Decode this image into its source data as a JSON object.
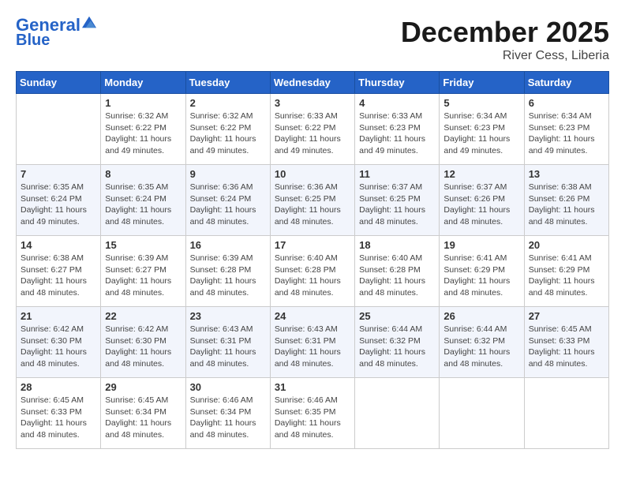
{
  "header": {
    "logo_line1": "General",
    "logo_line2": "Blue",
    "month": "December 2025",
    "location": "River Cess, Liberia"
  },
  "days_of_week": [
    "Sunday",
    "Monday",
    "Tuesday",
    "Wednesday",
    "Thursday",
    "Friday",
    "Saturday"
  ],
  "weeks": [
    [
      {
        "day": "",
        "sunrise": "",
        "sunset": "",
        "daylight": ""
      },
      {
        "day": "1",
        "sunrise": "Sunrise: 6:32 AM",
        "sunset": "Sunset: 6:22 PM",
        "daylight": "Daylight: 11 hours and 49 minutes."
      },
      {
        "day": "2",
        "sunrise": "Sunrise: 6:32 AM",
        "sunset": "Sunset: 6:22 PM",
        "daylight": "Daylight: 11 hours and 49 minutes."
      },
      {
        "day": "3",
        "sunrise": "Sunrise: 6:33 AM",
        "sunset": "Sunset: 6:22 PM",
        "daylight": "Daylight: 11 hours and 49 minutes."
      },
      {
        "day": "4",
        "sunrise": "Sunrise: 6:33 AM",
        "sunset": "Sunset: 6:23 PM",
        "daylight": "Daylight: 11 hours and 49 minutes."
      },
      {
        "day": "5",
        "sunrise": "Sunrise: 6:34 AM",
        "sunset": "Sunset: 6:23 PM",
        "daylight": "Daylight: 11 hours and 49 minutes."
      },
      {
        "day": "6",
        "sunrise": "Sunrise: 6:34 AM",
        "sunset": "Sunset: 6:23 PM",
        "daylight": "Daylight: 11 hours and 49 minutes."
      }
    ],
    [
      {
        "day": "7",
        "sunrise": "Sunrise: 6:35 AM",
        "sunset": "Sunset: 6:24 PM",
        "daylight": "Daylight: 11 hours and 49 minutes."
      },
      {
        "day": "8",
        "sunrise": "Sunrise: 6:35 AM",
        "sunset": "Sunset: 6:24 PM",
        "daylight": "Daylight: 11 hours and 48 minutes."
      },
      {
        "day": "9",
        "sunrise": "Sunrise: 6:36 AM",
        "sunset": "Sunset: 6:24 PM",
        "daylight": "Daylight: 11 hours and 48 minutes."
      },
      {
        "day": "10",
        "sunrise": "Sunrise: 6:36 AM",
        "sunset": "Sunset: 6:25 PM",
        "daylight": "Daylight: 11 hours and 48 minutes."
      },
      {
        "day": "11",
        "sunrise": "Sunrise: 6:37 AM",
        "sunset": "Sunset: 6:25 PM",
        "daylight": "Daylight: 11 hours and 48 minutes."
      },
      {
        "day": "12",
        "sunrise": "Sunrise: 6:37 AM",
        "sunset": "Sunset: 6:26 PM",
        "daylight": "Daylight: 11 hours and 48 minutes."
      },
      {
        "day": "13",
        "sunrise": "Sunrise: 6:38 AM",
        "sunset": "Sunset: 6:26 PM",
        "daylight": "Daylight: 11 hours and 48 minutes."
      }
    ],
    [
      {
        "day": "14",
        "sunrise": "Sunrise: 6:38 AM",
        "sunset": "Sunset: 6:27 PM",
        "daylight": "Daylight: 11 hours and 48 minutes."
      },
      {
        "day": "15",
        "sunrise": "Sunrise: 6:39 AM",
        "sunset": "Sunset: 6:27 PM",
        "daylight": "Daylight: 11 hours and 48 minutes."
      },
      {
        "day": "16",
        "sunrise": "Sunrise: 6:39 AM",
        "sunset": "Sunset: 6:28 PM",
        "daylight": "Daylight: 11 hours and 48 minutes."
      },
      {
        "day": "17",
        "sunrise": "Sunrise: 6:40 AM",
        "sunset": "Sunset: 6:28 PM",
        "daylight": "Daylight: 11 hours and 48 minutes."
      },
      {
        "day": "18",
        "sunrise": "Sunrise: 6:40 AM",
        "sunset": "Sunset: 6:28 PM",
        "daylight": "Daylight: 11 hours and 48 minutes."
      },
      {
        "day": "19",
        "sunrise": "Sunrise: 6:41 AM",
        "sunset": "Sunset: 6:29 PM",
        "daylight": "Daylight: 11 hours and 48 minutes."
      },
      {
        "day": "20",
        "sunrise": "Sunrise: 6:41 AM",
        "sunset": "Sunset: 6:29 PM",
        "daylight": "Daylight: 11 hours and 48 minutes."
      }
    ],
    [
      {
        "day": "21",
        "sunrise": "Sunrise: 6:42 AM",
        "sunset": "Sunset: 6:30 PM",
        "daylight": "Daylight: 11 hours and 48 minutes."
      },
      {
        "day": "22",
        "sunrise": "Sunrise: 6:42 AM",
        "sunset": "Sunset: 6:30 PM",
        "daylight": "Daylight: 11 hours and 48 minutes."
      },
      {
        "day": "23",
        "sunrise": "Sunrise: 6:43 AM",
        "sunset": "Sunset: 6:31 PM",
        "daylight": "Daylight: 11 hours and 48 minutes."
      },
      {
        "day": "24",
        "sunrise": "Sunrise: 6:43 AM",
        "sunset": "Sunset: 6:31 PM",
        "daylight": "Daylight: 11 hours and 48 minutes."
      },
      {
        "day": "25",
        "sunrise": "Sunrise: 6:44 AM",
        "sunset": "Sunset: 6:32 PM",
        "daylight": "Daylight: 11 hours and 48 minutes."
      },
      {
        "day": "26",
        "sunrise": "Sunrise: 6:44 AM",
        "sunset": "Sunset: 6:32 PM",
        "daylight": "Daylight: 11 hours and 48 minutes."
      },
      {
        "day": "27",
        "sunrise": "Sunrise: 6:45 AM",
        "sunset": "Sunset: 6:33 PM",
        "daylight": "Daylight: 11 hours and 48 minutes."
      }
    ],
    [
      {
        "day": "28",
        "sunrise": "Sunrise: 6:45 AM",
        "sunset": "Sunset: 6:33 PM",
        "daylight": "Daylight: 11 hours and 48 minutes."
      },
      {
        "day": "29",
        "sunrise": "Sunrise: 6:45 AM",
        "sunset": "Sunset: 6:34 PM",
        "daylight": "Daylight: 11 hours and 48 minutes."
      },
      {
        "day": "30",
        "sunrise": "Sunrise: 6:46 AM",
        "sunset": "Sunset: 6:34 PM",
        "daylight": "Daylight: 11 hours and 48 minutes."
      },
      {
        "day": "31",
        "sunrise": "Sunrise: 6:46 AM",
        "sunset": "Sunset: 6:35 PM",
        "daylight": "Daylight: 11 hours and 48 minutes."
      },
      {
        "day": "",
        "sunrise": "",
        "sunset": "",
        "daylight": ""
      },
      {
        "day": "",
        "sunrise": "",
        "sunset": "",
        "daylight": ""
      },
      {
        "day": "",
        "sunrise": "",
        "sunset": "",
        "daylight": ""
      }
    ]
  ]
}
